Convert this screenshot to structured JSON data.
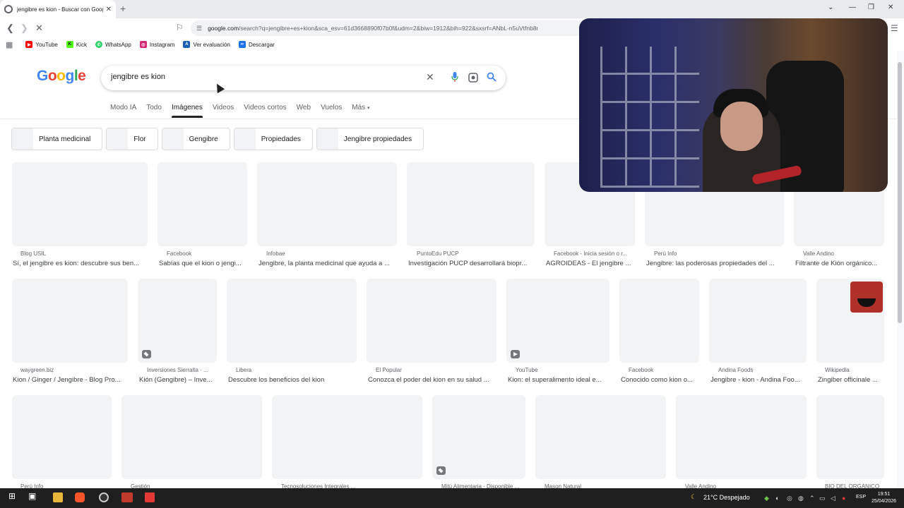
{
  "browser": {
    "tab_title": "jengibre es kion - Buscar con Google",
    "url_host": "google.com",
    "url_rest": "/search?q=jengibre+es+kion&sca_esv=61d3668890f07b0f&udm=2&biw=1912&bih=922&sxsrf=ANbL-n5uVtfnb8r",
    "bookmarks": [
      {
        "label": "YouTube",
        "icon": "youtube-icon",
        "color": "#ff0000"
      },
      {
        "label": "Kick",
        "icon": "kick-icon",
        "color": "#1a1a1a"
      },
      {
        "label": "WhatsApp",
        "icon": "whatsapp-icon",
        "color": "#25d366"
      },
      {
        "label": "Instagram",
        "icon": "instagram-icon",
        "color": "#d62976"
      },
      {
        "label": "Ver evaluación",
        "icon": "evaluation-icon",
        "color": "#1a5fb4"
      },
      {
        "label": "Descargar",
        "icon": "download-icon",
        "color": "#1a73e8"
      }
    ]
  },
  "google": {
    "logo": "Google",
    "query": "jengibre es kion",
    "tabs": [
      "Modo IA",
      "Todo",
      "Imágenes",
      "Videos",
      "Videos cortos",
      "Web",
      "Vuelos",
      "Más"
    ],
    "active_tab": "Imágenes",
    "chips": [
      "Planta medicinal",
      "Flor",
      "Gengibre",
      "Propiedades",
      "Jengibre propiedades"
    ]
  },
  "results": {
    "row1": [
      {
        "source": "Blog USIL",
        "title": "Sí, el jengibre es kion: descubre sus ben..."
      },
      {
        "source": "Facebook",
        "title": "Sabías que el kion o jengi..."
      },
      {
        "source": "Infobae",
        "title": "Jengibre, la planta medicinal que ayuda a ..."
      },
      {
        "source": "PuntoEdu PUCP",
        "title": "Investigación PUCP desarrollará biopr..."
      },
      {
        "source": "Facebook - Inicia sesión o r...",
        "title": "AGROIDEAS - El jengibre ..."
      },
      {
        "source": "Perú Info",
        "title": "Jengibre: las poderosas propiedades del ..."
      },
      {
        "source": "Valle Andino",
        "title": "Filtrante de Kión orgánico..."
      }
    ],
    "row2": [
      {
        "source": "waygreen.biz",
        "title": "Kion / Ginger / Jengibre - Blog Pro..."
      },
      {
        "source": "Inversiones Sierralta · ...",
        "title": "Kión (Gengibre) – Inve..."
      },
      {
        "source": "Libera",
        "title": "Descubre los beneficios del kion"
      },
      {
        "source": "El Popular",
        "title": "Conozca el poder del kion en su salud ..."
      },
      {
        "source": "YouTube",
        "title": "Kion: el superalimento ideal e..."
      },
      {
        "source": "Facebook",
        "title": "Conocido como kion o..."
      },
      {
        "source": "Andina Foods",
        "title": "Jengibre - kion - Andina Foo..."
      },
      {
        "source": "Wikipedia",
        "title": "Zingiber officinale ..."
      }
    ],
    "row3": [
      {
        "source": "Perú Info"
      },
      {
        "source": "Gestión"
      },
      {
        "source": "Tecnosoluciones Integrales ..."
      },
      {
        "source": "Mitú Alimentaria · Disponible ..."
      },
      {
        "source": "Mason Natural"
      },
      {
        "source": "Valle Andino"
      },
      {
        "source": "BIO DEL ORGANICO"
      }
    ]
  },
  "taskbar": {
    "weather": "21°C  Despejado",
    "language": "ESP",
    "time": "19:51",
    "date": "25/04/2026"
  }
}
